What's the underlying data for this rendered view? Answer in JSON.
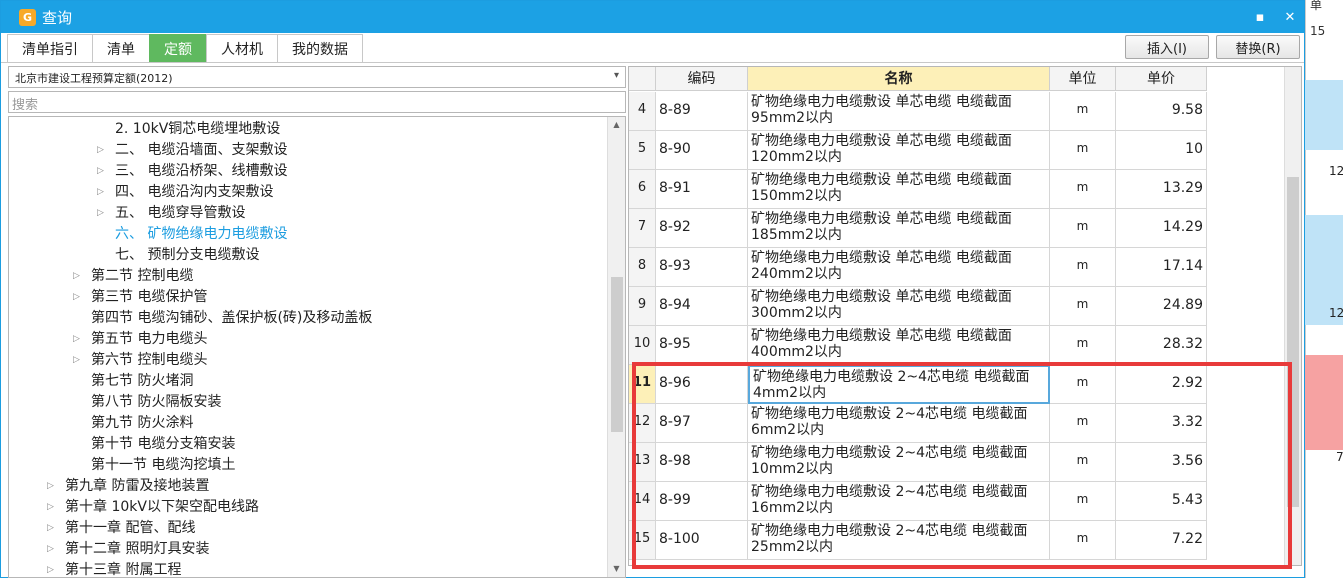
{
  "window": {
    "title": "查询",
    "app_icon_glyph": "G",
    "minimize_glyph": "▪",
    "maximize_glyph": "▭",
    "close_glyph": "✕"
  },
  "tabs": [
    {
      "label": "清单指引"
    },
    {
      "label": "清单"
    },
    {
      "label": "定额",
      "active": true
    },
    {
      "label": "人材机"
    },
    {
      "label": "我的数据"
    }
  ],
  "actions": {
    "insert_label": "插入(I)",
    "replace_label": "替换(R)"
  },
  "left": {
    "quota_library": "北京市建设工程预算定额(2012)",
    "search_placeholder": "搜索",
    "tree": [
      {
        "text": "2. 10kV铜芯电缆埋地敷设",
        "indent": 3,
        "expander": false
      },
      {
        "text": "二、 电缆沿墙面、支架敷设",
        "indent": 3,
        "expander": true
      },
      {
        "text": "三、 电缆沿桥架、线槽敷设",
        "indent": 3,
        "expander": true
      },
      {
        "text": "四、 电缆沿沟内支架敷设",
        "indent": 3,
        "expander": true
      },
      {
        "text": "五、 电缆穿导管敷设",
        "indent": 3,
        "expander": true
      },
      {
        "text": "六、 矿物绝缘电力电缆敷设",
        "indent": 3,
        "expander": false,
        "selected": true
      },
      {
        "text": "七、 预制分支电缆敷设",
        "indent": 3,
        "expander": false
      },
      {
        "text": "第二节 控制电缆",
        "indent": 2,
        "expander": true
      },
      {
        "text": "第三节 电缆保护管",
        "indent": 2,
        "expander": true
      },
      {
        "text": "第四节 电缆沟铺砂、盖保护板(砖)及移动盖板",
        "indent": 2,
        "expander": false
      },
      {
        "text": "第五节 电力电缆头",
        "indent": 2,
        "expander": true
      },
      {
        "text": "第六节 控制电缆头",
        "indent": 2,
        "expander": true
      },
      {
        "text": "第七节 防火堵洞",
        "indent": 2,
        "expander": false
      },
      {
        "text": "第八节 防火隔板安装",
        "indent": 2,
        "expander": false
      },
      {
        "text": "第九节 防火涂料",
        "indent": 2,
        "expander": false
      },
      {
        "text": "第十节 电缆分支箱安装",
        "indent": 2,
        "expander": false
      },
      {
        "text": "第十一节 电缆沟挖填土",
        "indent": 2,
        "expander": false
      },
      {
        "text": "第九章 防雷及接地装置",
        "indent": 1,
        "expander": true
      },
      {
        "text": "第十章 10kV以下架空配电线路",
        "indent": 1,
        "expander": true
      },
      {
        "text": "第十一章 配管、配线",
        "indent": 1,
        "expander": true
      },
      {
        "text": "第十二章 照明灯具安装",
        "indent": 1,
        "expander": true
      },
      {
        "text": "第十三章 附属工程",
        "indent": 1,
        "expander": true
      }
    ]
  },
  "grid": {
    "headers": {
      "code": "编码",
      "name": "名称",
      "unit": "单位",
      "price": "单价"
    },
    "rows": [
      {
        "idx": "4",
        "code": "8-89",
        "name1": "矿物绝缘电力电缆敷设 单芯电缆 电缆截面",
        "name2": "95mm2以内",
        "unit": "m",
        "price": "9.58"
      },
      {
        "idx": "5",
        "code": "8-90",
        "name1": "矿物绝缘电力电缆敷设 单芯电缆 电缆截面",
        "name2": "120mm2以内",
        "unit": "m",
        "price": "10"
      },
      {
        "idx": "6",
        "code": "8-91",
        "name1": "矿物绝缘电力电缆敷设 单芯电缆 电缆截面",
        "name2": "150mm2以内",
        "unit": "m",
        "price": "13.29"
      },
      {
        "idx": "7",
        "code": "8-92",
        "name1": "矿物绝缘电力电缆敷设 单芯电缆 电缆截面",
        "name2": "185mm2以内",
        "unit": "m",
        "price": "14.29"
      },
      {
        "idx": "8",
        "code": "8-93",
        "name1": "矿物绝缘电力电缆敷设 单芯电缆 电缆截面",
        "name2": "240mm2以内",
        "unit": "m",
        "price": "17.14"
      },
      {
        "idx": "9",
        "code": "8-94",
        "name1": "矿物绝缘电力电缆敷设 单芯电缆 电缆截面",
        "name2": "300mm2以内",
        "unit": "m",
        "price": "24.89"
      },
      {
        "idx": "10",
        "code": "8-95",
        "name1": "矿物绝缘电力电缆敷设 单芯电缆 电缆截面",
        "name2": "400mm2以内",
        "unit": "m",
        "price": "28.32"
      },
      {
        "idx": "11",
        "code": "8-96",
        "name1": "矿物绝缘电力电缆敷设 2~4芯电缆 电缆截面",
        "name2": "4mm2以内",
        "unit": "m",
        "price": "2.92",
        "current": true
      },
      {
        "idx": "12",
        "code": "8-97",
        "name1": "矿物绝缘电力电缆敷设 2~4芯电缆 电缆截面",
        "name2": "6mm2以内",
        "unit": "m",
        "price": "3.32"
      },
      {
        "idx": "13",
        "code": "8-98",
        "name1": "矿物绝缘电力电缆敷设 2~4芯电缆 电缆截面",
        "name2": "10mm2以内",
        "unit": "m",
        "price": "3.56"
      },
      {
        "idx": "14",
        "code": "8-99",
        "name1": "矿物绝缘电力电缆敷设 2~4芯电缆 电缆截面",
        "name2": "16mm2以内",
        "unit": "m",
        "price": "5.43"
      },
      {
        "idx": "15",
        "code": "8-100",
        "name1": "矿物绝缘电力电缆敷设 2~4芯电缆 电缆截面",
        "name2": "25mm2以内",
        "unit": "m",
        "price": "7.22"
      }
    ]
  },
  "background": {
    "cells": [
      "单",
      "15",
      "12",
      "12",
      "7"
    ]
  },
  "colors": {
    "titlebar": "#1ca1e4",
    "active_tab": "#5fb95f",
    "highlight_box": "#e83a3a",
    "name_header": "#fdf0b8",
    "selected_tree": "#1c9de0"
  }
}
